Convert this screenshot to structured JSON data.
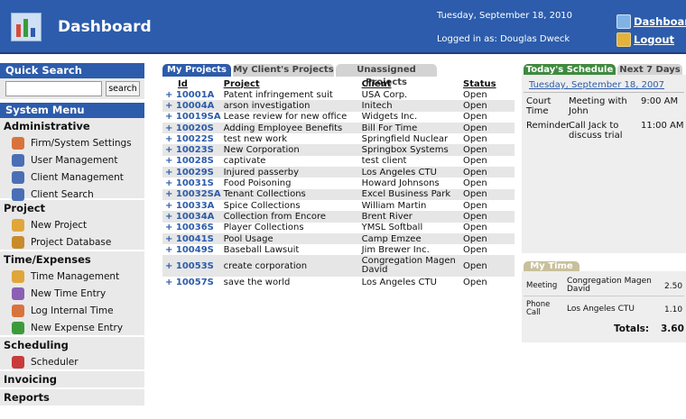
{
  "header": {
    "title": "Dashboard",
    "date": "Tuesday, September 18, 2010",
    "login": "Logged in as: Douglas Dweck",
    "dashboard_link": "Dashboard",
    "logout_link": "Logout"
  },
  "sidebar": {
    "quick_search": {
      "title": "Quick Search",
      "button": "search",
      "value": ""
    },
    "system_menu_title": "System Menu",
    "groups": [
      {
        "title": "Administrative",
        "items": [
          "Firm/System Settings",
          "User Management",
          "Client Management",
          "Client Search"
        ]
      },
      {
        "title": "Project",
        "items": [
          "New Project",
          "Project Database"
        ]
      },
      {
        "title": "Time/Expenses",
        "items": [
          "Time Management",
          "New Time Entry",
          "Log Internal Time",
          "New Expense Entry"
        ]
      },
      {
        "title": "Scheduling",
        "items": [
          "Scheduler"
        ]
      },
      {
        "title": "Invoicing",
        "items": []
      },
      {
        "title": "Reports",
        "items": []
      }
    ]
  },
  "projects": {
    "tabs": [
      "My Projects",
      "My Client's Projects",
      "Unassigned Projects"
    ],
    "columns": [
      "Id",
      "Project",
      "Client",
      "Status"
    ],
    "rows": [
      {
        "id": "10001A",
        "project": "Patent infringement suit",
        "client": "USA Corp.",
        "status": "Open"
      },
      {
        "id": "10004A",
        "project": "arson investigation",
        "client": "Initech",
        "status": "Open"
      },
      {
        "id": "10019SA",
        "project": "Lease review for new office",
        "client": "Widgets Inc.",
        "status": "Open"
      },
      {
        "id": "10020S",
        "project": "Adding Employee Benefits",
        "client": "Bill For Time",
        "status": "Open"
      },
      {
        "id": "10022S",
        "project": "test new work",
        "client": "Springfield Nuclear",
        "status": "Open"
      },
      {
        "id": "10023S",
        "project": "New Corporation",
        "client": "Springbox Systems",
        "status": "Open"
      },
      {
        "id": "10028S",
        "project": "captivate",
        "client": "test client",
        "status": "Open"
      },
      {
        "id": "10029S",
        "project": "Injured passerby",
        "client": "Los Angeles CTU",
        "status": "Open"
      },
      {
        "id": "10031S",
        "project": "Food Poisoning",
        "client": "Howard Johnsons",
        "status": "Open"
      },
      {
        "id": "10032SA",
        "project": "Tenant Collections",
        "client": "Excel Business Park",
        "status": "Open"
      },
      {
        "id": "10033A",
        "project": "Spice Collections",
        "client": "William Martin",
        "status": "Open"
      },
      {
        "id": "10034A",
        "project": "Collection from Encore",
        "client": "Brent River",
        "status": "Open"
      },
      {
        "id": "10036S",
        "project": "Player Collections",
        "client": "YMSL Softball",
        "status": "Open"
      },
      {
        "id": "10041S",
        "project": "Pool Usage",
        "client": "Camp Emzee",
        "status": "Open"
      },
      {
        "id": "10049S",
        "project": "Baseball Lawsuit",
        "client": "Jim Brewer Inc.",
        "status": "Open"
      },
      {
        "id": "10053S",
        "project": "create corporation",
        "client": "Congregation Magen David",
        "status": "Open"
      },
      {
        "id": "10057S",
        "project": "save the world",
        "client": "Los Angeles CTU",
        "status": "Open"
      }
    ]
  },
  "schedule": {
    "tabs": [
      "Today's Schedule",
      "Next 7 Days"
    ],
    "date": "Tuesday, September 18, 2007",
    "events": [
      {
        "type": "Court Time",
        "desc": "Meeting with John",
        "time": "9:00 AM"
      },
      {
        "type": "Reminder",
        "desc": "Call Jack to discuss trial",
        "time": "11:00 AM"
      }
    ]
  },
  "my_time": {
    "tab": "My Time",
    "rows": [
      {
        "type": "Meeting",
        "client": "Congregation Magen David",
        "hours": "2.50"
      },
      {
        "type": "Phone Call",
        "client": "Los Angeles CTU",
        "hours": "1.10"
      }
    ],
    "totals_label": "Totals:",
    "totals_value": "3.60"
  },
  "colors": {
    "header_blue": "#2c5cab",
    "schedule_green": "#3f8a3f",
    "my_time_tan": "#c8c09a"
  }
}
